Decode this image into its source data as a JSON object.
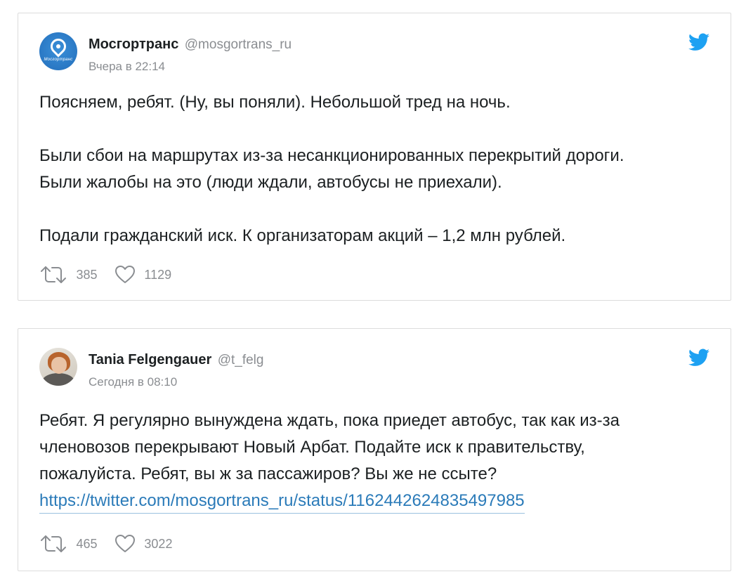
{
  "tweets": [
    {
      "author": {
        "name": "Мосгортранс",
        "handle": "@mosgortrans_ru",
        "avatar_icon": "mosgortrans-logo",
        "avatar_logo_text": "Мосгортранс"
      },
      "time": "Вчера в 22:14",
      "text": "Поясняем, ребят. (Ну, вы поняли). Небольшой тред на ночь.\n\nБыли сбои на маршрутах из-за несанкционированных перекрытий дороги.\nБыли жалобы на это (люди ждали, автобусы не приехали).\n\nПодали гражданский иск. К организаторам акций – 1,2 млн рублей.",
      "retweets": "385",
      "likes": "1129"
    },
    {
      "author": {
        "name": "Tania Felgengauer",
        "handle": "@t_felg",
        "avatar_icon": "user-photo"
      },
      "time": "Сегодня в 08:10",
      "text": "Ребят. Я регулярно вынуждена ждать, пока приедет автобус, так как из-за\nчленовозов перекрывают Новый Арбат. Подайте иск к правительству,\nпожалуйста. Ребят, вы ж за пассажиров? Вы же не ссыте?\n",
      "link": "https://twitter.com/mosgortrans_ru/status/1162442624835497985",
      "retweets": "465",
      "likes": "3022"
    }
  ],
  "icons": {
    "brand": "twitter-bird-icon",
    "retweet": "retweet-icon",
    "like": "heart-icon"
  },
  "colors": {
    "twitter_blue": "#1da1f2",
    "link": "#2b7bb9",
    "muted": "#8a8d91",
    "text": "#1c2022",
    "border": "#dcdcdc"
  }
}
